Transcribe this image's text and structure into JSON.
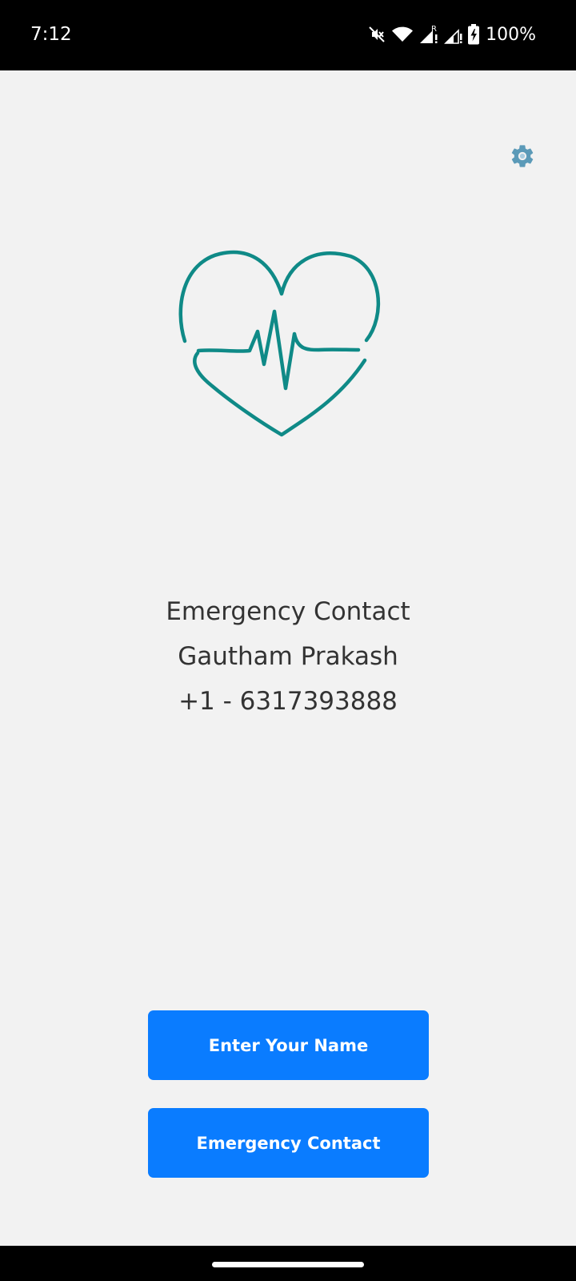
{
  "status_bar": {
    "time": "7:12",
    "battery_text": "100%",
    "icons": [
      "mute-icon",
      "wifi-icon",
      "signal-roaming-icon",
      "signal-icon",
      "battery-charging-icon"
    ]
  },
  "settings": {
    "icon": "gear-icon",
    "color": "#5b9ab8"
  },
  "logo": {
    "icon": "heart-pulse-icon",
    "color": "#0f8a87"
  },
  "contact": {
    "heading": "Emergency Contact",
    "name": "Gautham Prakash",
    "phone": "+1 - 6317393888"
  },
  "buttons": {
    "enter_name": "Enter Your Name",
    "emergency_contact": "Emergency Contact",
    "color": "#0a7cff"
  }
}
